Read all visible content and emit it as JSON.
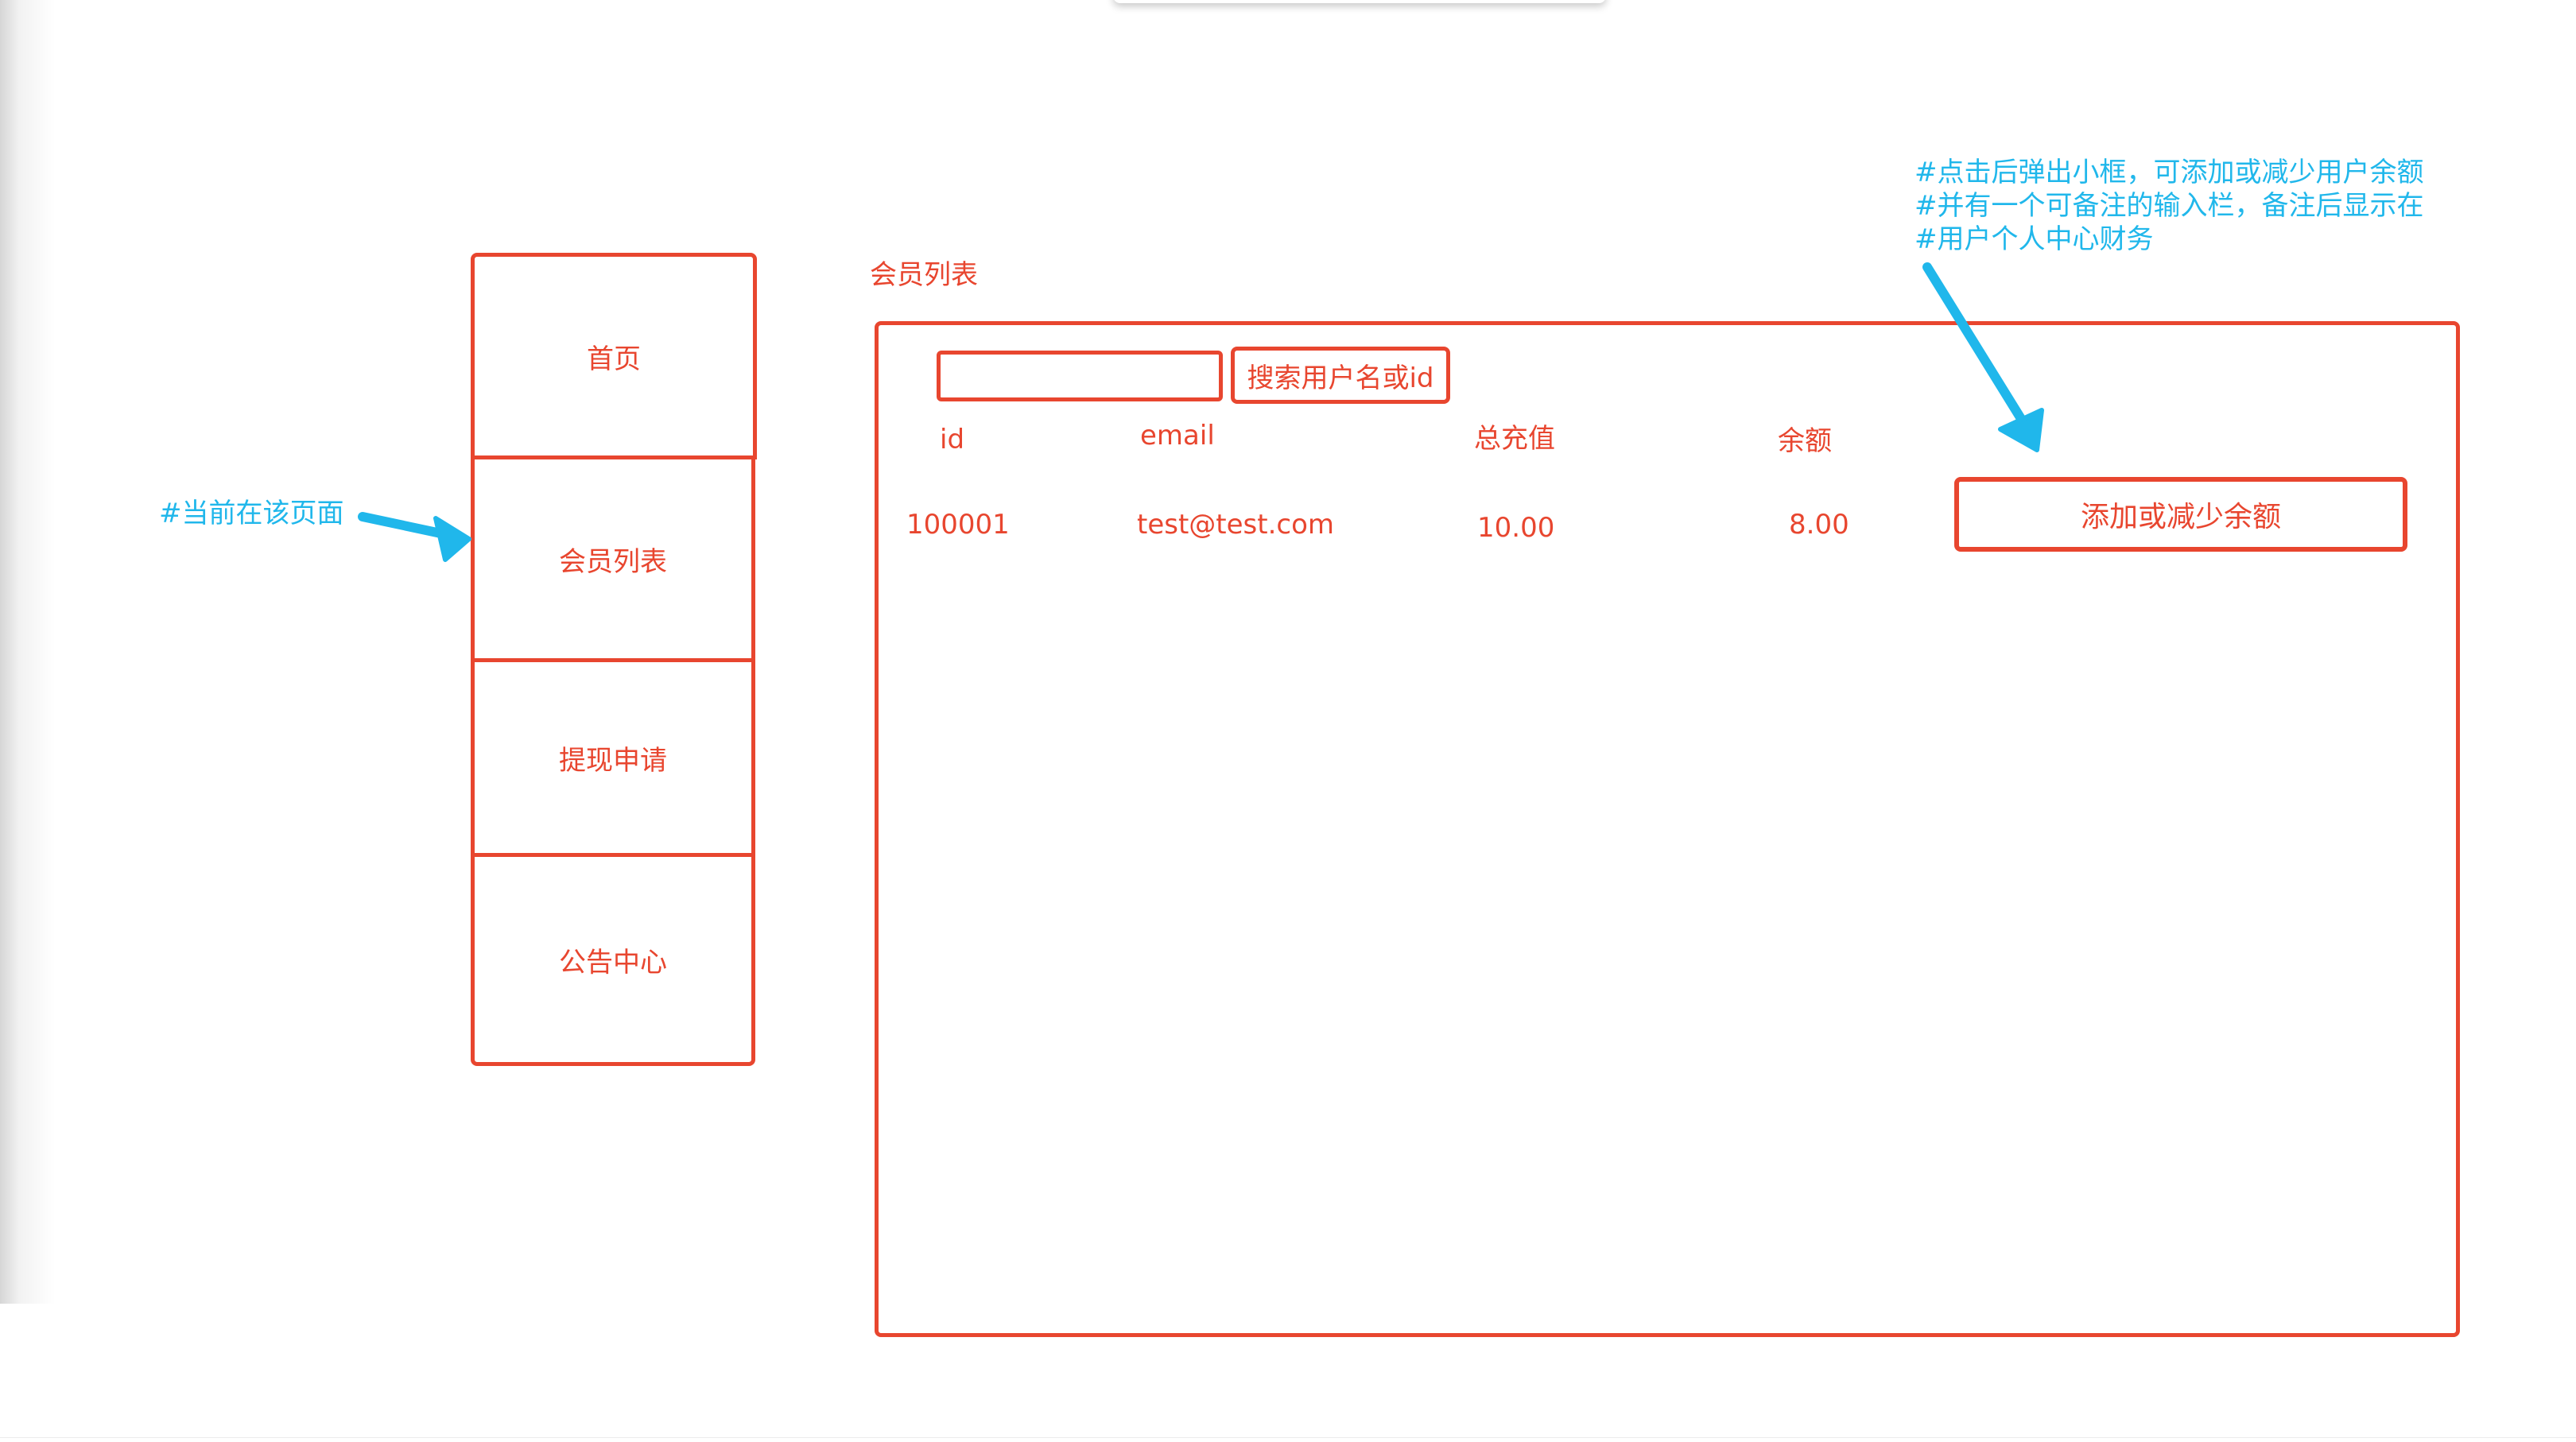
{
  "sidebar": {
    "items": [
      {
        "label": "首页"
      },
      {
        "label": "会员列表"
      },
      {
        "label": "提现申请"
      },
      {
        "label": "公告中心"
      }
    ]
  },
  "main": {
    "title": "会员列表",
    "search": {
      "placeholder": "",
      "value": "",
      "button_label": "搜索用户名或id"
    },
    "table": {
      "headers": [
        "id",
        "email",
        "总充值",
        "余额"
      ],
      "rows": [
        {
          "id": "100001",
          "email": "test@test.com",
          "total_recharge": "10.00",
          "balance": "8.00",
          "action_label": "添加或减少余额"
        }
      ]
    }
  },
  "annotations": {
    "current_page": "#当前在该页面",
    "adjust_note_lines": [
      "#点击后弹出小框，可添加或减少用户余额",
      "#并有一个可备注的输入栏，备注后显示在",
      "#用户个人中心财务"
    ]
  },
  "colors": {
    "wireframe_red": "#e8462f",
    "annotation_cyan": "#20b7eb",
    "background": "#ffffff"
  },
  "icons": [
    "arrow-icon"
  ]
}
